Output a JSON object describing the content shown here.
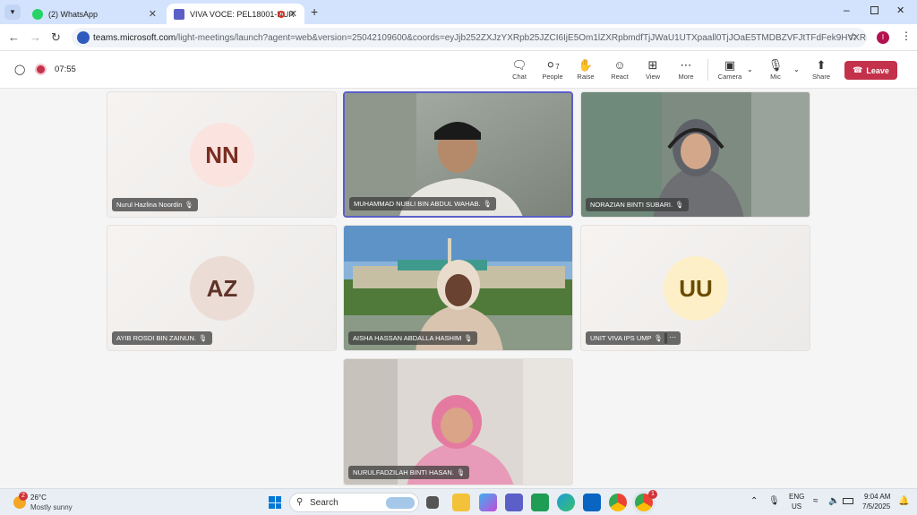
{
  "browser": {
    "tabs": [
      {
        "title": "(2) WhatsApp",
        "active": false
      },
      {
        "title": "VIVA VOCE: PEL18001-NUR",
        "active": true
      }
    ],
    "url_host": "teams.microsoft.com",
    "url_path": "/light-meetings/launch?agent=web&version=25042109600&coords=eyJjb252ZXJzYXRpb25JZCI6IjE5Om1lZXRpbmdfTjJWaU1UTXpaall0TjJOaE5TMDBZVFJtTFdFek9HVXRNalUwT0d..."
  },
  "meeting": {
    "timer": "07:55",
    "toolbar": {
      "chat": "Chat",
      "people": "People",
      "people_count": "7",
      "raise": "Raise",
      "react": "React",
      "view": "View",
      "more": "More",
      "camera": "Camera",
      "mic": "Mic",
      "share": "Share",
      "leave": "Leave"
    },
    "participants": [
      {
        "name": "Nurul Hazlina Noordin",
        "initials": "NN",
        "avatar_bg": "#fbe3df",
        "avatar_fg": "#7a2e22"
      },
      {
        "name": "MUHAMMAD NUBLI BIN ABDUL WAHAB.",
        "video": true
      },
      {
        "name": "NORAZIAN BINTI SUBARI.",
        "video": true
      },
      {
        "name": "AYIB ROSDI BIN ZAINUN.",
        "initials": "AZ",
        "avatar_bg": "#ecdcd6",
        "avatar_fg": "#5e3328"
      },
      {
        "name": "AISHA HASSAN ABDALLA HASHIM",
        "video": true
      },
      {
        "name": "UNIT VIVA IPS UMP",
        "initials": "UU",
        "avatar_bg": "#fdf0c8",
        "avatar_fg": "#6b4b00"
      },
      {
        "name": "NURULFADZILAH BINTI HASAN.",
        "video": true
      }
    ]
  },
  "taskbar": {
    "weather_temp": "26°C",
    "weather_desc": "Mostly sunny",
    "weather_badge": "2",
    "search_placeholder": "Search",
    "lang_top": "ENG",
    "lang_bottom": "US",
    "time": "9:04 AM",
    "date": "7/5/2025",
    "chrome_badge": "1"
  },
  "colors": {
    "teams_accent": "#5b5fc7",
    "leave_red": "#c4314b"
  }
}
